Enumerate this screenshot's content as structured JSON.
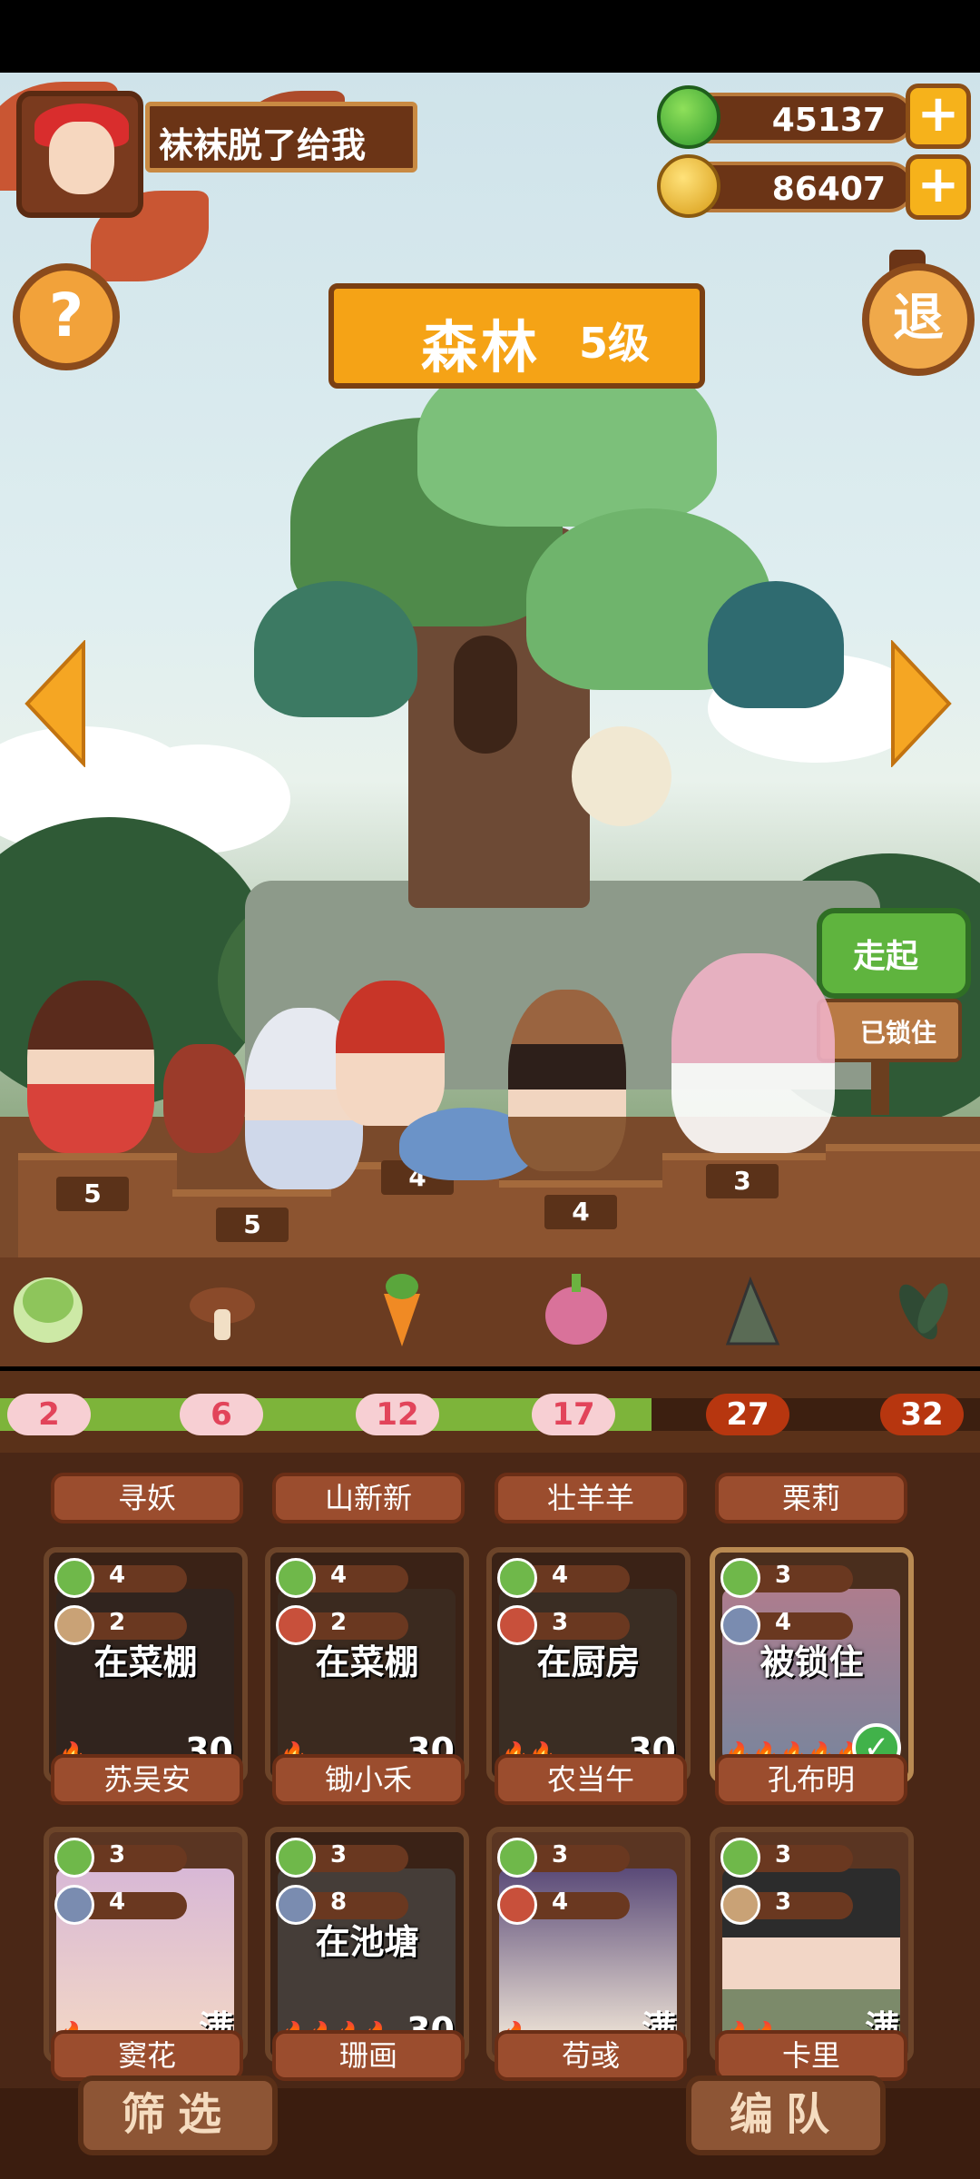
{
  "player": {
    "name": "袜袜脱了给我"
  },
  "currency": [
    {
      "icon": "green-apple-icon",
      "value": "45137",
      "plus": "+"
    },
    {
      "icon": "gold-coin-icon",
      "value": "86407",
      "plus": "+"
    }
  ],
  "buttons": {
    "help": "?",
    "exit": "退"
  },
  "area": {
    "name": "森林",
    "level": "5级"
  },
  "signs": {
    "walk": "走起",
    "locked": "已锁住"
  },
  "stage_levels": [
    "5",
    "5",
    "4",
    "4",
    "3"
  ],
  "ingredients": [
    {
      "icon": "cabbage-icon",
      "count": "2",
      "unlocked": true
    },
    {
      "icon": "mushroom-icon",
      "count": "6",
      "unlocked": true
    },
    {
      "icon": "carrot-icon",
      "count": "12",
      "unlocked": true
    },
    {
      "icon": "onion-icon",
      "count": "17",
      "unlocked": true
    },
    {
      "icon": "bamboo-shoot-icon",
      "count": "27",
      "unlocked": false
    },
    {
      "icon": "herb-leaf-icon",
      "count": "32",
      "unlocked": false
    }
  ],
  "progress": 0.665,
  "top_names": [
    "寻妖",
    "山新新",
    "壮羊羊",
    "栗莉"
  ],
  "cards_row1": [
    {
      "name": "苏吴安",
      "stat1": "4",
      "stat2": "2",
      "status": "在菜棚",
      "level": "30",
      "flames": "🔥"
    },
    {
      "name": "锄小禾",
      "stat1": "4",
      "stat2": "2",
      "status": "在菜棚",
      "level": "30",
      "flames": "🔥"
    },
    {
      "name": "农当午",
      "stat1": "4",
      "stat2": "3",
      "status": "在厨房",
      "level": "30",
      "flames": "🔥🔥"
    },
    {
      "name": "孔布明",
      "stat1": "3",
      "stat2": "4",
      "status": "被锁住",
      "level": "",
      "flames": "🔥🔥🔥🔥🔥"
    }
  ],
  "cards_row2": [
    {
      "name": "窦花",
      "stat1": "3",
      "stat2": "4",
      "status": "",
      "level": "满",
      "flames": "🔥"
    },
    {
      "name": "珊画",
      "stat1": "3",
      "stat2": "8",
      "status": "在池塘",
      "level": "30",
      "flames": "🔥🔥🔥🔥"
    },
    {
      "name": "苟彧",
      "stat1": "3",
      "stat2": "4",
      "status": "",
      "level": "满",
      "flames": "🔥"
    },
    {
      "name": "卡里",
      "stat1": "3",
      "stat2": "3",
      "status": "",
      "level": "满",
      "flames": "🔥🔥"
    }
  ],
  "bottom": {
    "filter": "筛选",
    "team": "编队"
  },
  "colors": {
    "accent": "#f5a316",
    "panel": "#4a2716",
    "progress": "#7db43a"
  }
}
